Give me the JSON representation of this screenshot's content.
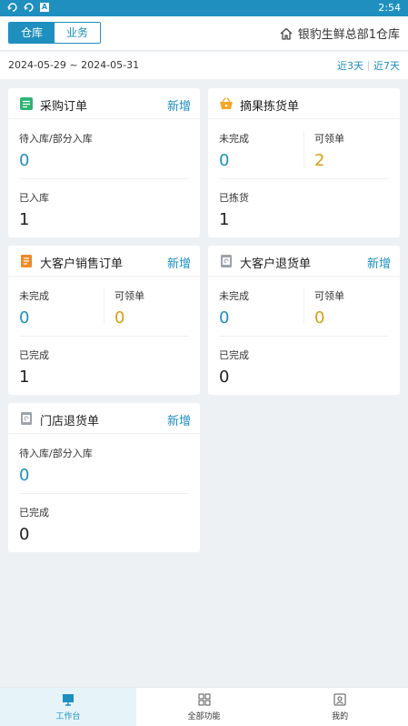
{
  "status_bar": {
    "time": "2:54",
    "icons": [
      "rotate-icon",
      "rotate-icon",
      "a-icon"
    ]
  },
  "header": {
    "tabs": [
      {
        "label": "仓库",
        "active": true
      },
      {
        "label": "业务",
        "active": false
      }
    ],
    "warehouse_name": "银豹生鲜总部1仓库",
    "warehouse_icon": "home-icon"
  },
  "date_bar": {
    "range": "2024-05-29 ~ 2024-05-31",
    "quick_3": "近3天",
    "quick_7": "近7天"
  },
  "cards": {
    "purchase": {
      "title": "采购订单",
      "add": "新增",
      "icon": "list-icon",
      "s1_label": "待入库/部分入库",
      "s1_value": "0",
      "s2_label": "已入库",
      "s2_value": "1"
    },
    "picking": {
      "title": "摘果拣货单",
      "add": "",
      "icon": "basket-icon",
      "s1_label": "未完成",
      "s1_value": "0",
      "s2_label": "可领单",
      "s2_value": "2",
      "s3_label": "已拣货",
      "s3_value": "1"
    },
    "bulk_sale": {
      "title": "大客户销售订单",
      "add": "新增",
      "icon": "receipt-icon",
      "s1_label": "未完成",
      "s1_value": "0",
      "s2_label": "可领单",
      "s2_value": "0",
      "s3_label": "已完成",
      "s3_value": "1"
    },
    "bulk_return": {
      "title": "大客户退货单",
      "add": "新增",
      "icon": "return-doc-icon",
      "s1_label": "未完成",
      "s1_value": "0",
      "s2_label": "可领单",
      "s2_value": "0",
      "s3_label": "已完成",
      "s3_value": "0"
    },
    "store_return": {
      "title": "门店退货单",
      "add": "新增",
      "icon": "return-doc-icon",
      "s1_label": "待入库/部分入库",
      "s1_value": "0",
      "s2_label": "已完成",
      "s2_value": "0"
    }
  },
  "tab_bar": [
    {
      "label": "工作台",
      "icon": "workbench-icon",
      "active": true
    },
    {
      "label": "全部功能",
      "icon": "grid-icon",
      "active": false
    },
    {
      "label": "我的",
      "icon": "profile-icon",
      "active": false
    }
  ],
  "colors": {
    "accent": "#1e8fbf",
    "warning": "#d4a017",
    "green": "#2bb673",
    "orange": "#f08a24"
  }
}
